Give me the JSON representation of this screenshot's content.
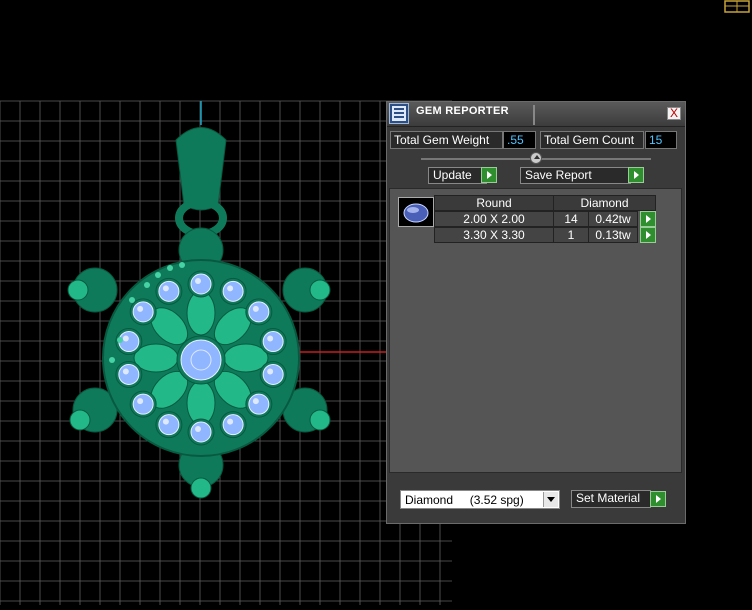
{
  "panel": {
    "title": "GEM REPORTER",
    "close_label": "X",
    "total_gem_weight_label": "Total Gem Weight",
    "total_gem_weight_value": ".55",
    "total_gem_count_label": "Total Gem Count",
    "total_gem_count_value": "15",
    "update_label": "Update",
    "save_report_label": "Save Report",
    "table": {
      "shape": "Round",
      "material": "Diamond",
      "rows": [
        {
          "size": "2.00 X 2.00",
          "count": "14",
          "weight": "0.42tw"
        },
        {
          "size": "3.30 X 3.30",
          "count": "1",
          "weight": "0.13tw"
        }
      ]
    },
    "material_select_value": "Diamond     (3.52 spg)",
    "set_material_label": "Set Material"
  },
  "colors": {
    "model_green": "#0f7a5a",
    "gem_blue": "#8fb6ff",
    "grid_line": "#5f5f5f",
    "accent_value": "#4fc3ff"
  }
}
